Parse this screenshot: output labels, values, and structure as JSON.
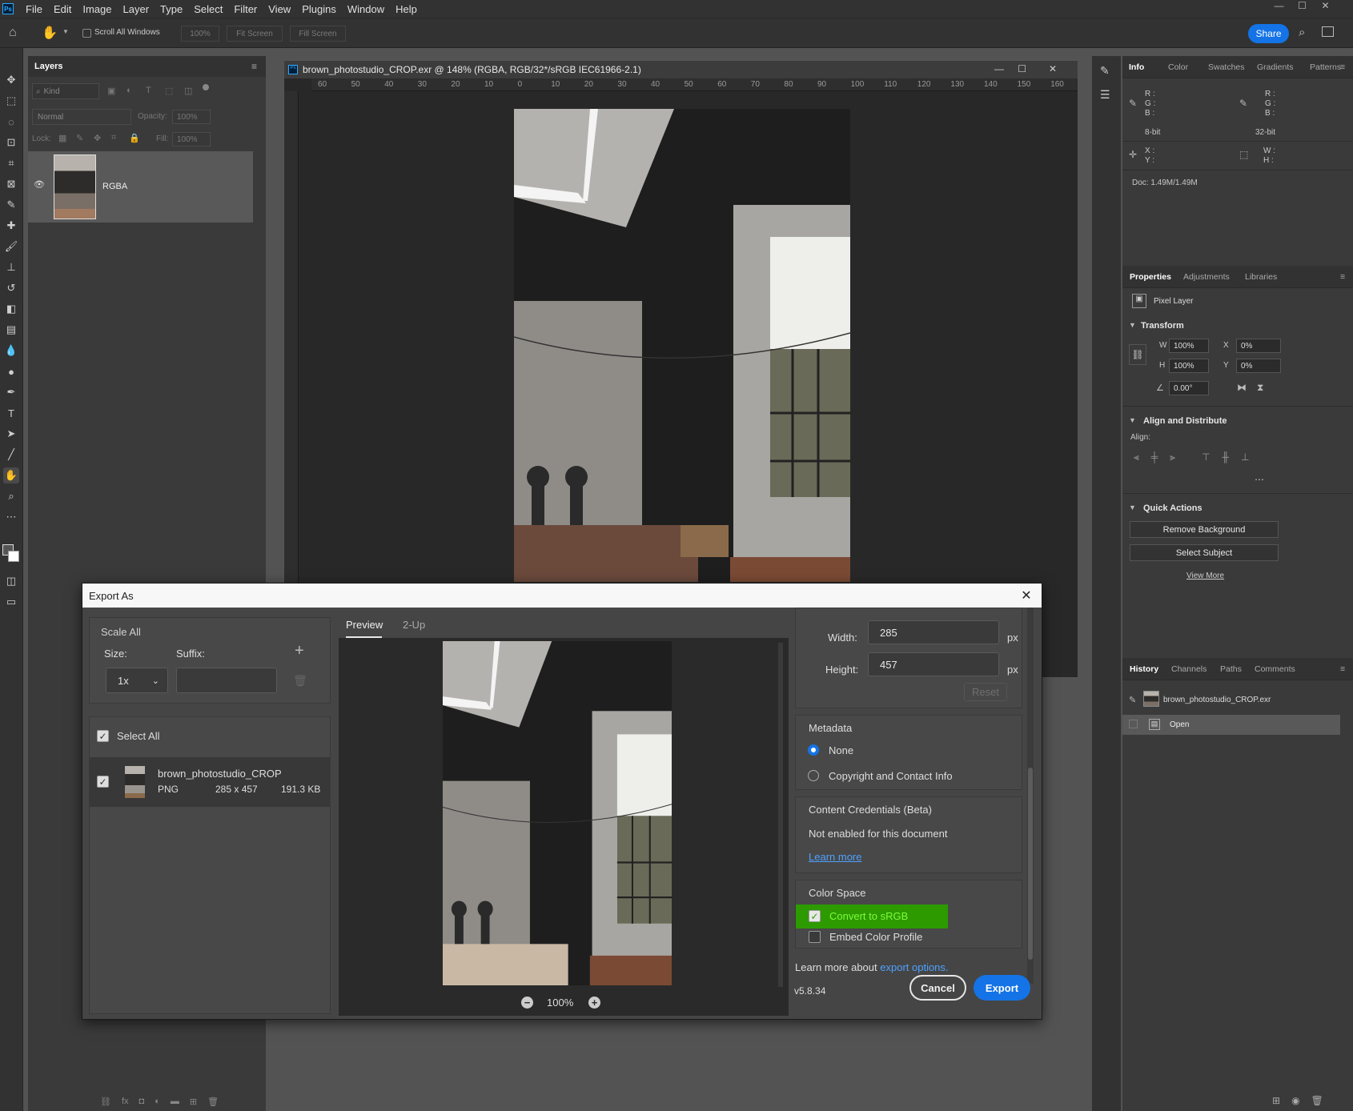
{
  "menu": [
    "File",
    "Edit",
    "Image",
    "Layer",
    "Type",
    "Select",
    "Filter",
    "View",
    "Plugins",
    "Window",
    "Help"
  ],
  "app_badge": "Ps",
  "options": {
    "scroll_all_windows": "Scroll All Windows",
    "zoom": "100%",
    "fit_screen": "Fit Screen",
    "fill_screen": "Fill Screen",
    "share": "Share"
  },
  "layers_panel": {
    "tab": "Layers",
    "kind_placeholder": "Kind",
    "blend_mode": "Normal",
    "opacity_label": "Opacity:",
    "opacity_value": "100%",
    "lock_label": "Lock:",
    "fill_label": "Fill:",
    "fill_value": "100%",
    "layer_name": "RGBA",
    "footer_icons": [
      "link-icon",
      "fx-icon",
      "mask-icon",
      "adjustment-icon",
      "folder-icon",
      "new-layer-icon",
      "trash-icon"
    ]
  },
  "document": {
    "title": "brown_photostudio_CROP.exr @ 148% (RGBA, RGB/32*/sRGB IEC61966-2.1)",
    "ruler_labels": [
      "60",
      "50",
      "40",
      "30",
      "20",
      "10",
      "0",
      "10",
      "20",
      "30",
      "40",
      "50",
      "60",
      "70",
      "80",
      "90",
      "100",
      "110",
      "120",
      "130",
      "140",
      "150",
      "160"
    ]
  },
  "info_panel": {
    "tabs": [
      "Info",
      "Color",
      "Swatches",
      "Gradients",
      "Patterns"
    ],
    "rgb_labels": [
      "R :",
      "G :",
      "B :"
    ],
    "bit_left": "8-bit",
    "bit_right": "32-bit",
    "xy_labels": [
      "X :",
      "Y :"
    ],
    "wh_labels": [
      "W :",
      "H :"
    ],
    "doc_size": "Doc: 1.49M/1.49M"
  },
  "properties_panel": {
    "tabs": [
      "Properties",
      "Adjustments",
      "Libraries"
    ],
    "layer_type": "Pixel Layer",
    "transform_title": "Transform",
    "w_label": "W",
    "w_value": "100%",
    "h_label": "H",
    "h_value": "100%",
    "x_label": "X",
    "x_value": "0%",
    "y_label": "Y",
    "y_value": "0%",
    "angle_value": "0.00°",
    "align_title": "Align and Distribute",
    "align_label": "Align:",
    "quick_actions_title": "Quick Actions",
    "remove_bg": "Remove Background",
    "select_subject": "Select Subject",
    "view_more": "View More"
  },
  "history_panel": {
    "tabs": [
      "History",
      "Channels",
      "Paths",
      "Comments"
    ],
    "snapshot": "brown_photostudio_CROP.exr",
    "step": "Open"
  },
  "export_dialog": {
    "title": "Export As",
    "scale_all": "Scale All",
    "size_label": "Size:",
    "suffix_label": "Suffix:",
    "scale_value": "1x",
    "select_all": "Select All",
    "asset": {
      "name": "brown_photostudio_CROP",
      "format": "PNG",
      "dims": "285 x 457",
      "size": "191.3 KB"
    },
    "tabs": [
      "Preview",
      "2-Up"
    ],
    "zoom": "100%",
    "width_label": "Width:",
    "width_value": "285",
    "width_unit": "px",
    "height_label": "Height:",
    "height_value": "457",
    "height_unit": "px",
    "reset": "Reset",
    "metadata_title": "Metadata",
    "metadata_none": "None",
    "metadata_copyright": "Copyright and Contact Info",
    "credentials_title": "Content Credentials (Beta)",
    "credentials_text": "Not enabled for this document",
    "learn_more": "Learn more",
    "color_space_title": "Color Space",
    "convert_srgb": "Convert to sRGB",
    "embed_profile": "Embed Color Profile",
    "learn_more_prefix": "Learn more about",
    "export_options_link": "export options.",
    "version": "v5.8.34",
    "cancel": "Cancel",
    "export": "Export"
  },
  "colors": {
    "accent": "#1473e6",
    "highlight": "#2d9a00",
    "panel": "#3a3a3a"
  }
}
